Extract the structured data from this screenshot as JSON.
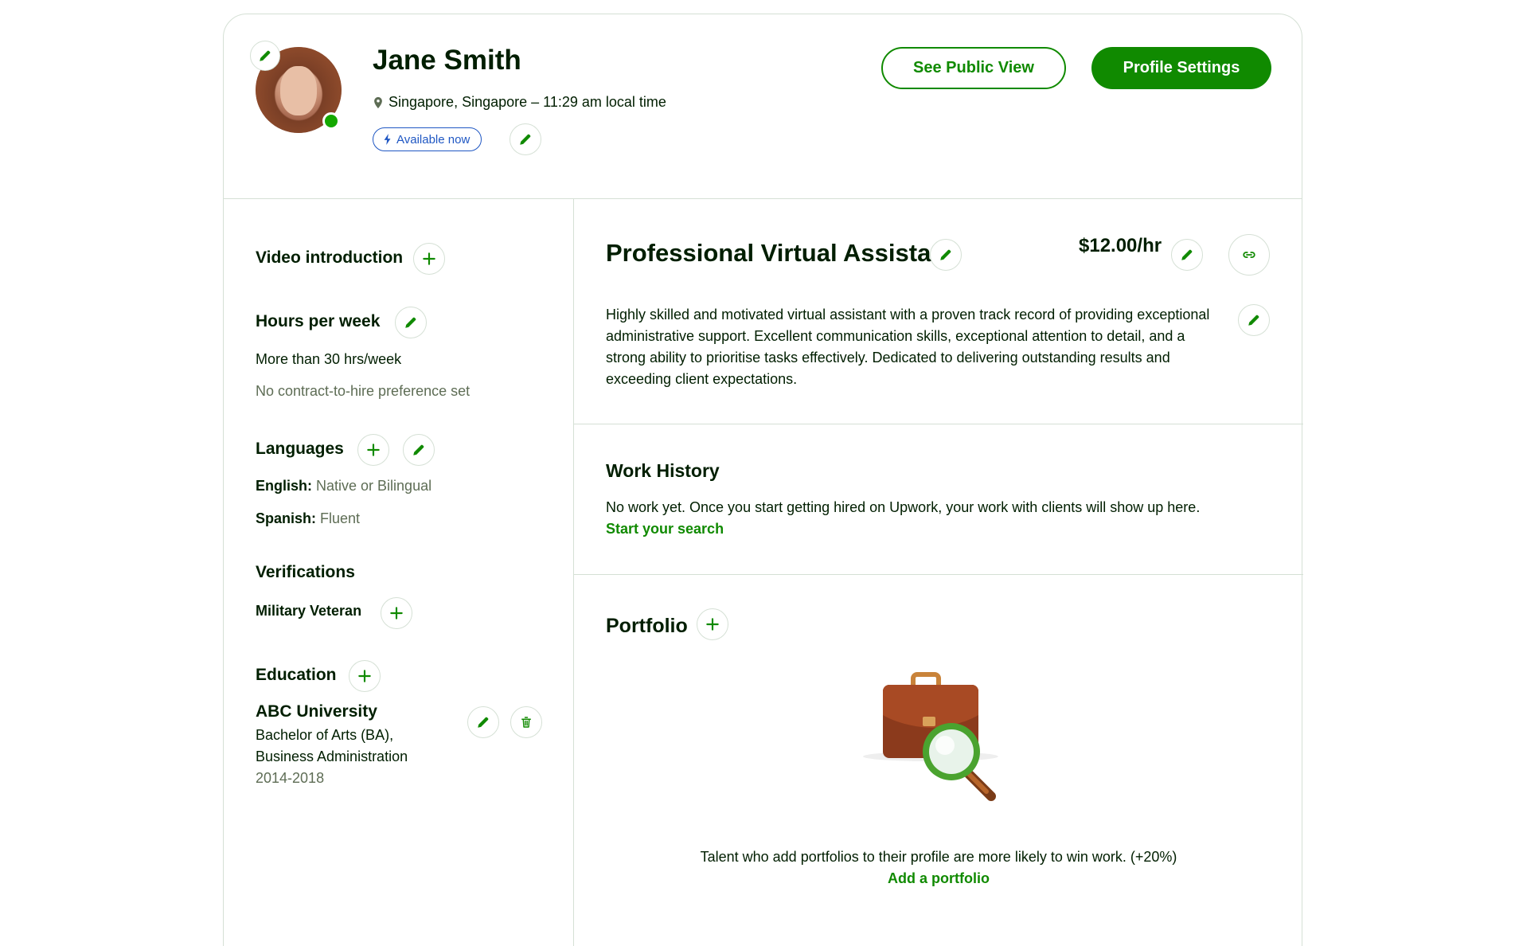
{
  "profile": {
    "name": "Jane Smith",
    "location": "Singapore, Singapore – 11:29 am local time",
    "availability": "Available now",
    "see_public_view": "See Public View",
    "profile_settings": "Profile Settings"
  },
  "sidebar": {
    "video_intro": "Video introduction",
    "hours_title": "Hours per week",
    "hours_value": "More than 30 hrs/week",
    "contract_pref": "No contract-to-hire preference set",
    "languages_title": "Languages",
    "languages": [
      {
        "name": "English:",
        "level": "Native or Bilingual"
      },
      {
        "name": "Spanish:",
        "level": "Fluent"
      }
    ],
    "verifications_title": "Verifications",
    "military": "Military Veteran",
    "education_title": "Education",
    "school": "ABC University",
    "degree_line1": "Bachelor of Arts (BA),",
    "degree_line2": "Business Administration",
    "years": "2014-2018"
  },
  "main": {
    "title": "Professional Virtual Assistant",
    "rate": "$12.00/hr",
    "overview": "Highly skilled and motivated virtual assistant with a proven track record of providing exceptional administrative support. Excellent communication skills, exceptional attention to detail, and a strong ability to prioritise tasks effectively. Dedicated to delivering outstanding results and exceeding client expectations.",
    "work_history_title": "Work History",
    "work_history_text": "No work yet. Once you start getting hired on Upwork, your work with clients will show up here.",
    "start_search": "Start your search",
    "portfolio_title": "Portfolio",
    "portfolio_text": "Talent who add portfolios to their profile are more likely to win work. (+20%)",
    "add_portfolio": "Add a portfolio"
  },
  "colors": {
    "brand_green": "#108a00",
    "available_blue": "#1f57c3",
    "border": "#d5e0d5",
    "online": "#14a800"
  },
  "icons": [
    "pencil-icon",
    "plus-icon",
    "link-icon",
    "trash-icon",
    "location-pin-icon",
    "bolt-icon",
    "briefcase-search-illustration"
  ]
}
